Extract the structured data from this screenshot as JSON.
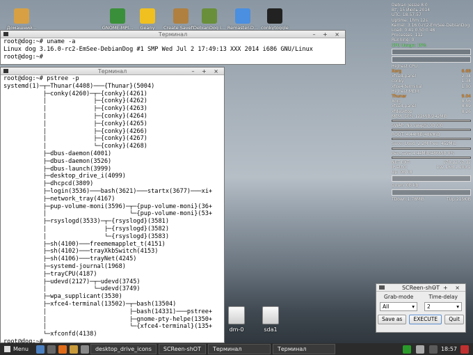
{
  "desktop_icons": [
    {
      "label": "Домашний...",
      "color": "#d8a043"
    },
    {
      "label": "GNOME-MPl...",
      "color": "#3a8f3a"
    },
    {
      "label": "Geany",
      "color": "#f0c020"
    },
    {
      "label": "Create Savefi...",
      "color": "#b08040"
    },
    {
      "label": "DebianDog i...",
      "color": "#6a8f3a"
    },
    {
      "label": "Remaster-D...",
      "color": "#4a8fe0"
    },
    {
      "label": "conkytoggle",
      "color": "#222222"
    }
  ],
  "term1": {
    "title": "Терминал",
    "lines": [
      "root@dog:~# uname -a",
      "Linux dog 3.16.0-rc2-EmSee-DebianDog #1 SMP Wed Jul 2 17:49:13 XXX 2014 i686 GNU/Linux",
      "root@dog:~# "
    ]
  },
  "term2": {
    "title": "Терминал",
    "lines": [
      "root@dog:~# pstree -p",
      "systemd(1)─┬─Thunar(4408)───{Thunar}(5004)",
      "           ├─conky(4260)─┬─{conky}(4261)",
      "           │             ├─{conky}(4262)",
      "           │             ├─{conky}(4263)",
      "           │             ├─{conky}(4264)",
      "           │             ├─{conky}(4265)",
      "           │             ├─{conky}(4266)",
      "           │             ├─{conky}(4267)",
      "           │             └─{conky}(4268)",
      "           ├─dbus-daemon(4001)",
      "           ├─dbus-daemon(3526)",
      "           ├─dbus-launch(3999)",
      "           ├─desktop_drive_i(4099)",
      "           ├─dhcpcd(3809)",
      "           ├─login(3536)───bash(3621)───startx(3677)───xi+",
      "           ├─network_tray(4167)",
      "           ├─pup-volume-moni(3596)─┬─{pup-volume-moni}(36+",
      "           │                       └─{pup-volume-moni}(53+",
      "           ├─rsyslogd(3533)─┬─{rsyslogd}(3581)",
      "           │                ├─{rsyslogd}(3582)",
      "           │                └─{rsyslogd}(3583)",
      "           ├─sh(4100)───freememapplet_t(4151)",
      "           ├─sh(4102)───trayXkbSwitch(4153)",
      "           ├─sh(4106)───trayNet(4245)",
      "           ├─systemd-journal(1968)",
      "           ├─trayCPU(4187)",
      "           ├─udevd(2127)─┬─udevd(3745)",
      "           │             └─udevd(3749)",
      "           ├─wpa_supplicant(3530)",
      "           ├─xfce4-terminal(13502)─┬─bash(13504)",
      "           │                       ├─bash(14331)───pstree+",
      "           │                       ├─gnome-pty-helpe(1350+",
      "           │                       └─{xfce4-terminal}(135+",
      "           └─xfconfd(4138)",
      "root@dog:~# "
    ]
  },
  "conky": {
    "header": [
      "Debian Jessie 8.0",
      "Вт, 15 Июль 2014",
      "UTC: 18:57:57",
      "Uptime: 1hm 12s",
      "Kernel: 3.16.0-rc2-EmSee-DebianDog",
      "Load: 0.41 0.50 0.48",
      "Processes: 112",
      "Running: 0"
    ],
    "cpu_usage": "CPU Usage: 19%",
    "highest_cpu_title": "Highest CPU:",
    "highest_cpu": [
      [
        "Xorg",
        "6.69"
      ],
      [
        "xfce4-panel",
        "2.34"
      ],
      [
        "conky",
        "1.34"
      ],
      [
        "xfce4-terminal",
        "1.00"
      ]
    ],
    "highest_mem_title": "Highest MEM:",
    "highest_mem": [
      [
        "Thunar",
        "9.04"
      ],
      [
        "Xorg",
        "8.56"
      ],
      [
        "xfce4-panel",
        "8.89"
      ],
      [
        "xfdesktop",
        "8.26"
      ]
    ],
    "mem": "MEM:          50% 122MiB/242MiB",
    "swap": "SWAP:         No swap% 0B /0B",
    "root": "ROOT:         4.44MiB/486MiB",
    "save": "Save: Used: 2.2M  Free: 452MiB",
    "dev": "dev_save 4.44MiB/486MiB 0%",
    "net": [
      [
        "NET EXT:",
        "178.12.57.12"
      ],
      [
        "IP eth0:",
        "192.168.1.100.2"
      ]
    ],
    "up": "Up: 0B  kB",
    "down": "Down: 0B  kB",
    "totals": [
      [
        "TDown:1.78MiB",
        "TUp:215KiB"
      ]
    ]
  },
  "drives": [
    {
      "label": "dm-0"
    },
    {
      "label": "sda1"
    }
  ],
  "screenshot_app": {
    "title": "SCReen-shOT",
    "grab_label": "Grab-mode",
    "delay_label": "Time-delay",
    "grab_value": "All",
    "delay_value": "2",
    "save_as": "Save as",
    "execute": "EXECUTE",
    "quit": "Quit"
  },
  "taskbar": {
    "menu": "Menu",
    "tasks": [
      "desktop_drive_icons",
      "SCReen-shOT",
      "Терминал",
      "Терминал"
    ],
    "time": "18:57"
  }
}
